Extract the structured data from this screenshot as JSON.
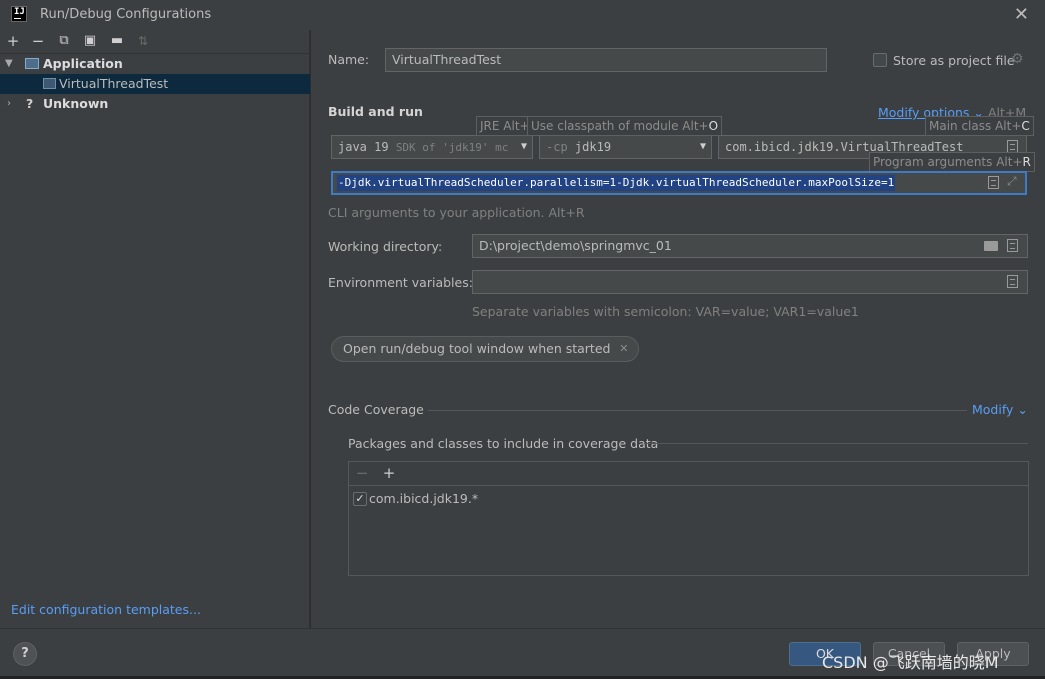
{
  "window": {
    "title": "Run/Debug Configurations",
    "logo_text": "IJ"
  },
  "toolbar": {
    "icons": [
      "add-icon",
      "remove-icon",
      "copy-icon",
      "save-icon",
      "new-folder-icon",
      "sort-icon"
    ]
  },
  "tree": {
    "application": "Application",
    "selected_config": "VirtualThreadTest",
    "unknown": "Unknown"
  },
  "left_footer": {
    "edit_templates": "Edit configuration templates..."
  },
  "form": {
    "name_label": "Name:",
    "name_value": "VirtualThreadTest",
    "store_label": "Store as project file",
    "build_run_heading": "Build and run",
    "modify_options": "Modify options",
    "modify_options_shortcut": "Alt+M",
    "jre_value_main": "java 19",
    "jre_value_hint": "SDK of 'jdk19' mc",
    "cp_value_prefix": "-cp",
    "cp_value": "jdk19",
    "main_class_value": "com.ibicd.jdk19.VirtualThreadTest",
    "program_args": "-Djdk.virtualThreadScheduler.parallelism=1-Djdk.virtualThreadScheduler.maxPoolSize=1",
    "cli_hint": "CLI arguments to your application. Alt+R",
    "working_dir_label": "Working directory:",
    "working_dir_value": "D:\\project\\demo\\springmvc_01",
    "env_label": "Environment variables:",
    "env_hint": "Separate variables with semicolon: VAR=value; VAR1=value1",
    "open_tool_window": "Open run/debug tool window when started",
    "code_coverage_label": "Code Coverage",
    "modify_link": "Modify",
    "packages_label": "Packages and classes to include in coverage data",
    "coverage_item": "com.ibicd.jdk19.*"
  },
  "tooltips": {
    "jre_text": "JRE Alt+",
    "classpath_text": "Use classpath of module Alt+",
    "classpath_key": "O",
    "main_class_text": "Main class Alt+",
    "main_class_key": "C",
    "program_args_text": "Program arguments Alt+",
    "program_args_key": "R"
  },
  "buttons": {
    "help": "?",
    "ok": "OK",
    "cancel": "Cancel",
    "apply": "Apply"
  },
  "watermark": "CSDN @飞跃南墙的晓M"
}
